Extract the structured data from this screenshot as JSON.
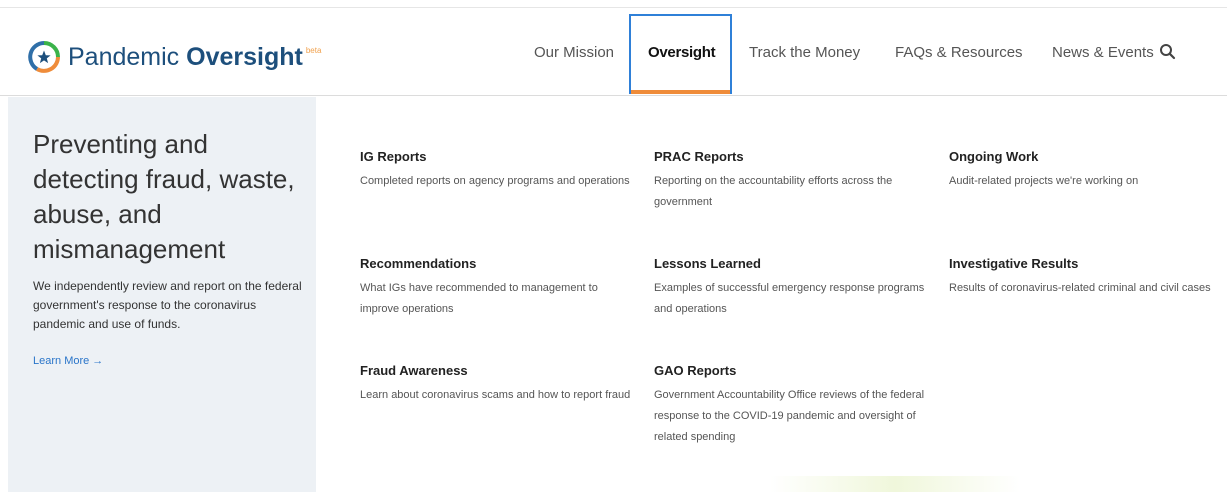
{
  "logo": {
    "name_part1": "Pandemic ",
    "name_part2": "Oversight",
    "beta": "beta"
  },
  "nav": {
    "items": [
      {
        "label": "Our Mission"
      },
      {
        "label": "Oversight"
      },
      {
        "label": "Track the Money"
      },
      {
        "label": "FAQs & Resources"
      },
      {
        "label": "News & Events"
      }
    ],
    "search_icon": "search-icon"
  },
  "panel": {
    "title": "Preventing and detecting fraud, waste, abuse, and mismanagement",
    "description": "We independently review and report on the federal government's response to the coronavirus pandemic and use of funds.",
    "learn_more": "Learn More →"
  },
  "menu": [
    {
      "title": "IG Reports",
      "description": "Completed reports on agency programs and operations"
    },
    {
      "title": "PRAC Reports",
      "description": "Reporting on the accountability efforts across the government"
    },
    {
      "title": "Ongoing Work",
      "description": "Audit-related projects we're working on"
    },
    {
      "title": "Recommendations",
      "description": "What IGs have recommended to management to improve operations"
    },
    {
      "title": "Lessons Learned",
      "description": "Examples of successful emergency response programs and operations"
    },
    {
      "title": "Investigative Results",
      "description": "Results of coronavirus-related criminal and civil cases"
    },
    {
      "title": "Fraud Awareness",
      "description": "Learn about coronavirus scams and how to report fraud"
    },
    {
      "title": "GAO Reports",
      "description": "Government Accountability Office reviews of the federal response to the COVID-19 pandemic and oversight of related spending"
    }
  ],
  "colors": {
    "brand": "#1d4f7c",
    "active_underline": "#ef8c3a",
    "focus_outline": "#2f80d8",
    "link": "#2a75c9"
  }
}
